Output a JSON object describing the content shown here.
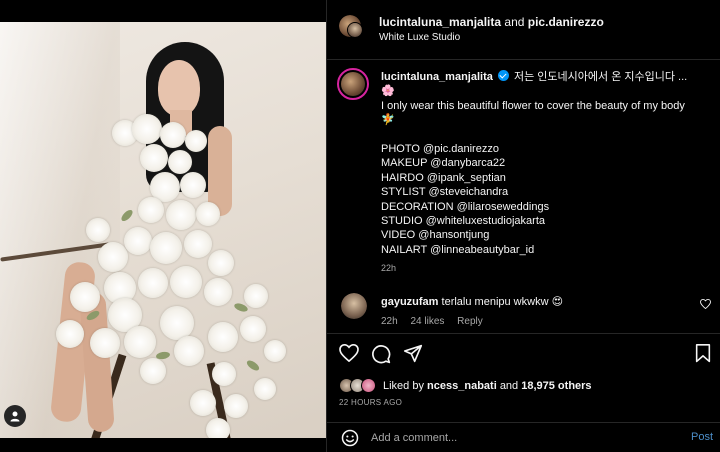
{
  "header": {
    "author": "lucintaluna_manjalita",
    "joiner": "and",
    "coauthor": "pic.danirezzo",
    "location": "White Luxe Studio"
  },
  "caption": {
    "username": "lucintaluna_manjalita",
    "korean": "저는 인도네시아에서 온 지수입니다 ...",
    "emoji1": "🌸",
    "line": "I only wear this beautiful flower to cover the beauty of my body",
    "emoji2": "🧚",
    "credits": [
      "PHOTO @pic.danirezzo",
      "MAKEUP @danybarca22",
      "HAIRDO @ipank_septian",
      "STYLIST @steveichandra",
      "DECORATION @lilaroseweddings",
      "STUDIO @whiteluxestudiojakarta",
      "VIDEO @hansontjung",
      "NAILART @linneabeautybar_id"
    ],
    "time": "22h"
  },
  "comment": {
    "username": "gayuzufam",
    "text": "terlalu menipu wkwkw",
    "emoji": "😍",
    "time": "22h",
    "likes": "24 likes",
    "reply": "Reply"
  },
  "likes": {
    "prefix": "Liked by",
    "user": "ncess_nabati",
    "joiner": "and",
    "others": "18,975 others"
  },
  "timestamp": "22 HOURS AGO",
  "add_comment": {
    "placeholder": "Add a comment...",
    "post": "Post"
  },
  "icons": {
    "like": "heart-icon",
    "comment": "comment-icon",
    "share": "share-icon",
    "save": "bookmark-icon",
    "emoji": "smiley-icon",
    "more": "more-icon",
    "user_tag": "user-tag-icon",
    "verified": "verified-badge-icon"
  },
  "colors": {
    "background": "#000000",
    "text": "#f5f5f5",
    "secondary": "#a8a8a8",
    "verified": "#0095f6",
    "post": "#4c8ec9"
  }
}
